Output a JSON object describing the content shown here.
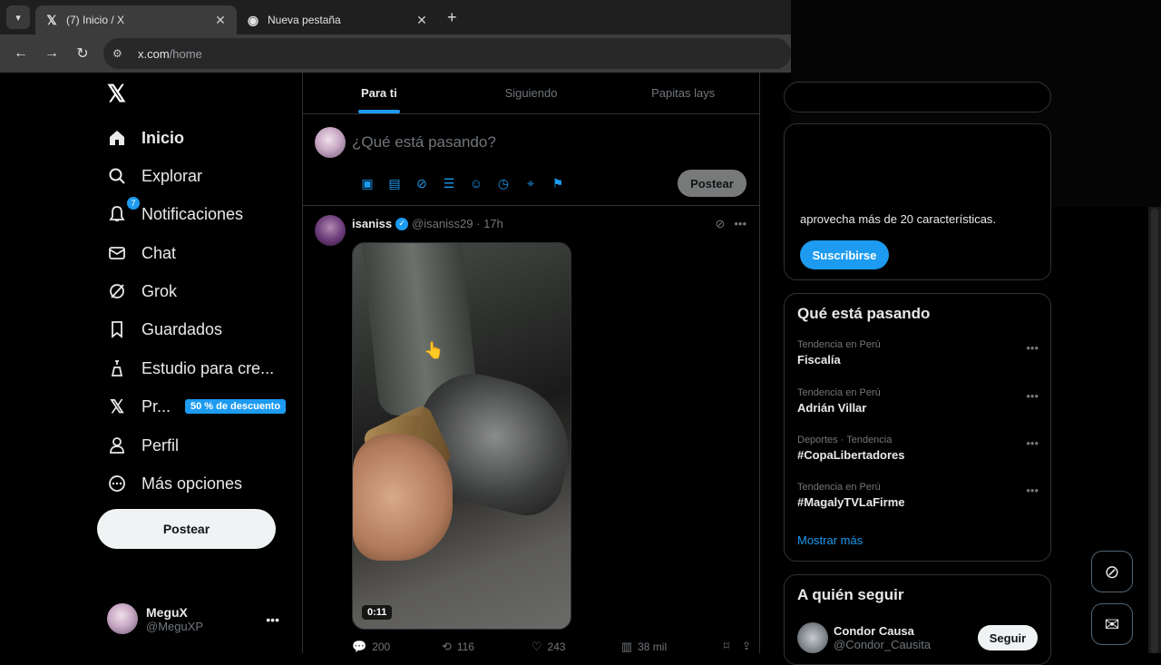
{
  "browser": {
    "tabs": [
      {
        "title": "(7) Inicio / X",
        "icon": "x-logo-icon",
        "active": true
      },
      {
        "title": "Nueva pestaña",
        "icon": "chrome-icon",
        "active": false
      }
    ],
    "url_domain": "x.com",
    "url_path": "/home"
  },
  "sidebar": {
    "logo": "𝕏",
    "items": [
      {
        "label": "Inicio",
        "icon": "home-icon"
      },
      {
        "label": "Explorar",
        "icon": "search-icon"
      },
      {
        "label": "Notificaciones",
        "icon": "bell-icon",
        "badge": "7"
      },
      {
        "label": "Chat",
        "icon": "mail-icon"
      },
      {
        "label": "Grok",
        "icon": "grok-icon"
      },
      {
        "label": "Guardados",
        "icon": "bookmark-icon"
      },
      {
        "label": "Estudio para cre...",
        "icon": "studio-icon"
      },
      {
        "label": "Pr...",
        "icon": "x-logo-icon",
        "promo": "50 % de descuento"
      },
      {
        "label": "Perfil",
        "icon": "person-icon"
      },
      {
        "label": "Más opciones",
        "icon": "more-circle-icon"
      }
    ],
    "post_label": "Postear",
    "user": {
      "name": "MeguX",
      "handle": "@MeguXP"
    }
  },
  "feed": {
    "tabs": [
      "Para ti",
      "Siguiendo",
      "Papitas lays"
    ],
    "compose_placeholder": "¿Qué está pasando?",
    "compose_post_label": "Postear",
    "tweet": {
      "user": "isaniss",
      "handle": "@isaniss29",
      "time": "17h",
      "duration": "0:11",
      "replies": "200",
      "reposts": "116",
      "likes": "243",
      "views": "38 mil"
    }
  },
  "right": {
    "premium_text": "aprovecha más de 20 características.",
    "subscribe_label": "Suscribirse",
    "trends_title": "Qué está pasando",
    "trends": [
      {
        "category": "Tendencia en Perú",
        "name": "Fiscalía"
      },
      {
        "category": "Tendencia en Perú",
        "name": "Adrián Villar"
      },
      {
        "category": "Deportes · Tendencia",
        "name": "#CopaLibertadores"
      },
      {
        "category": "Tendencia en Perú",
        "name": "#MagalyTVLaFirme"
      }
    ],
    "show_more": "Mostrar más",
    "follow_title": "A quién seguir",
    "follow_user": {
      "name": "Condor Causa",
      "handle": "@Condor_Causita"
    },
    "follow_label": "Seguir"
  },
  "colors": {
    "accent": "#1d9bf0",
    "background": "#000000",
    "text": "#e7e9ea",
    "muted": "#71767b"
  }
}
